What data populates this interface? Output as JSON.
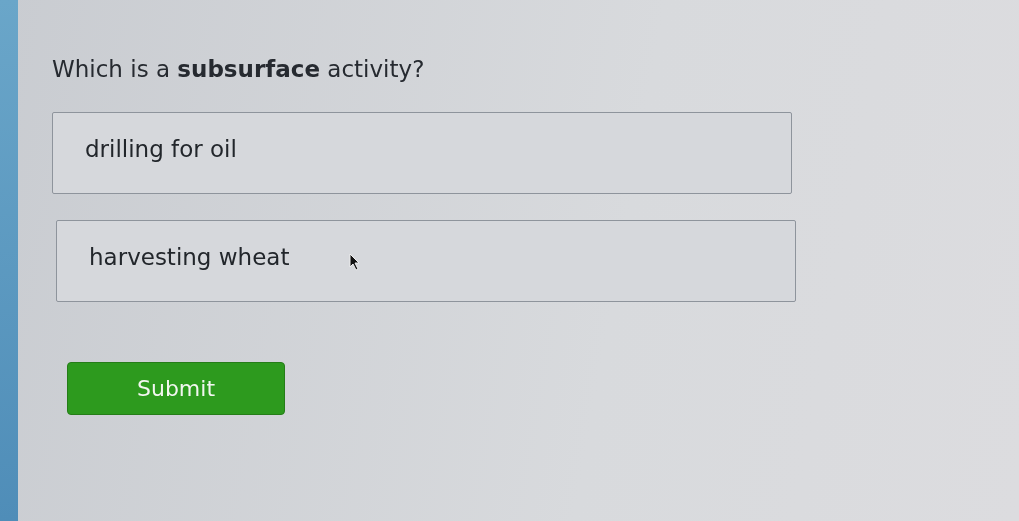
{
  "question": "Which is a **subsurface** activity?",
  "options": [
    {
      "label": "drilling for oil",
      "selected": false
    },
    {
      "label": "harvesting wheat",
      "selected": false
    }
  ],
  "submit_button": "Submit"
}
